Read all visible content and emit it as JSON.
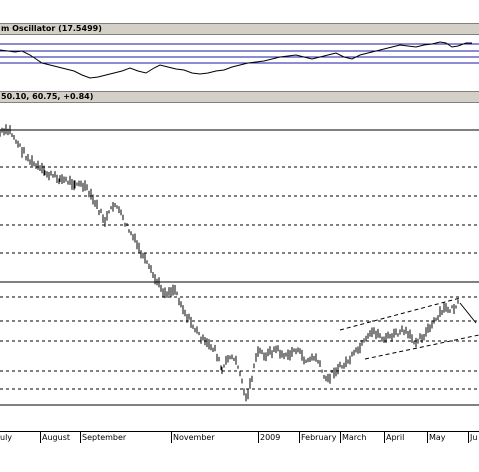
{
  "oscillator_panel": {
    "title": "m Oscillator (17.5499)"
  },
  "price_panel": {
    "title": "50.10, 60.75, +0.84)"
  },
  "colors": {
    "header_bg": "#d4d0c8",
    "osc_bands": "#1a1aa8",
    "price": "#000000",
    "gridline": "#000000"
  },
  "x_axis": {
    "labels": [
      "uly",
      "August",
      "September",
      "November",
      "2009",
      "February",
      "March",
      "April",
      "May",
      "Ju"
    ]
  }
}
